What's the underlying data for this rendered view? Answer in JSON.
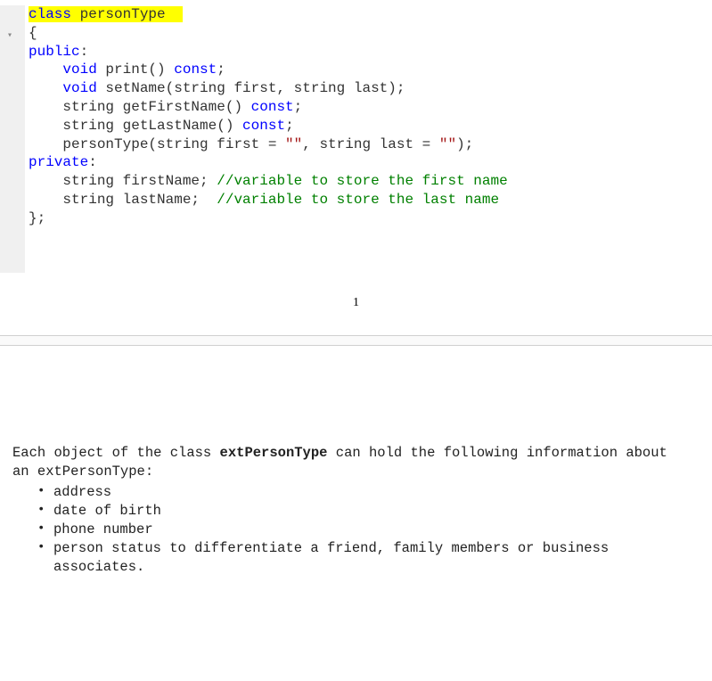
{
  "code": {
    "t_class": "class",
    "t_classname": " personType  ",
    "t_brace_open": "{",
    "t_public": "public",
    "t_void": "void",
    "t_const": "const",
    "t_private": "private",
    "l_print_a": "    ",
    "l_print_b": " print() ",
    "l_print_c": ";",
    "l_setname_a": "    ",
    "l_setname_b": " setName(string first, string last);",
    "l_getfirst": "    string getFirstName() ",
    "l_getfirst_c": ";",
    "l_getlast": "    string getLastName() ",
    "l_getlast_c": ";",
    "l_ctor_a": "    personType(string first = ",
    "l_ctor_s1": "\"\"",
    "l_ctor_b": ", string last = ",
    "l_ctor_s2": "\"\"",
    "l_ctor_c": ");",
    "l_firstname": "    string firstName; ",
    "l_firstname_cm": "//variable to store the first name",
    "l_lastname": "    string lastName;  ",
    "l_lastname_cm": "//variable to store the last name",
    "t_brace_close": "};"
  },
  "pagenum": "1",
  "para": {
    "p1_a": "Each object of the class ",
    "p1_b": "extPersonType",
    "p1_c": " can hold the following information about",
    "p2": "an extPersonType:"
  },
  "bullets": [
    "address",
    "date of birth",
    "phone number",
    "person status to differentiate a friend, family members or business\nassociates."
  ]
}
